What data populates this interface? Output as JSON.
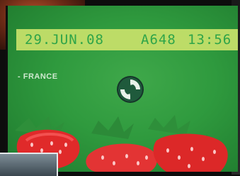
{
  "label": {
    "date": "29.JUN.08",
    "code": "A648",
    "time": "13:56",
    "country": "- FRANCE",
    "symbol_icon": "green-dot-icon"
  },
  "colors": {
    "label_green": "#2f9a3e",
    "print_band": "#c9e26b",
    "print_text": "#2fa64a",
    "strawberry_red": "#e02a2a"
  }
}
